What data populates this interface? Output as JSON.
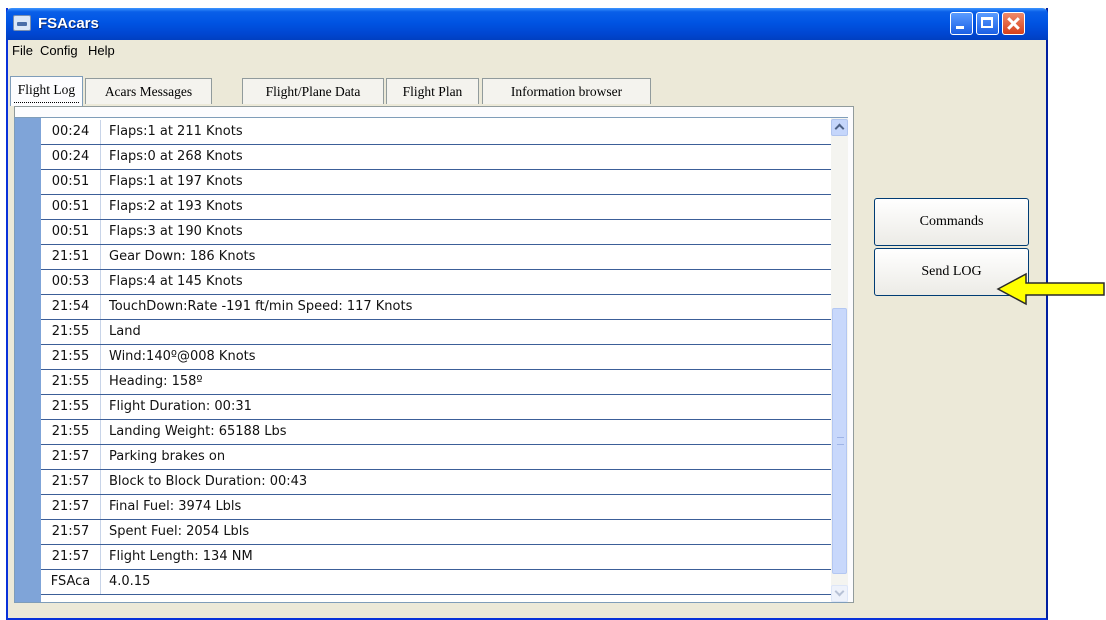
{
  "window": {
    "title": "FSAcars"
  },
  "menu": [
    "File",
    "Config",
    "Help"
  ],
  "tabs": [
    "Flight Log",
    "Acars Messages",
    "Flight/Plane Data",
    "Flight Plan",
    "Information browser"
  ],
  "log": [
    {
      "time": "00:24",
      "msg": "Flaps:1 at 211 Knots"
    },
    {
      "time": "00:24",
      "msg": "Flaps:0 at 268 Knots"
    },
    {
      "time": "00:51",
      "msg": "Flaps:1 at 197 Knots"
    },
    {
      "time": "00:51",
      "msg": "Flaps:2 at 193 Knots"
    },
    {
      "time": "00:51",
      "msg": "Flaps:3 at 190 Knots"
    },
    {
      "time": "21:51",
      "msg": "Gear Down: 186 Knots"
    },
    {
      "time": "00:53",
      "msg": "Flaps:4 at 145 Knots"
    },
    {
      "time": "21:54",
      "msg": "TouchDown:Rate -191 ft/min Speed: 117 Knots"
    },
    {
      "time": "21:55",
      "msg": "Land"
    },
    {
      "time": "21:55",
      "msg": "Wind:140º@008 Knots"
    },
    {
      "time": "21:55",
      "msg": "Heading: 158º"
    },
    {
      "time": "21:55",
      "msg": "Flight Duration: 00:31"
    },
    {
      "time": "21:55",
      "msg": "Landing Weight: 65188 Lbs"
    },
    {
      "time": "21:57",
      "msg": "Parking brakes on"
    },
    {
      "time": "21:57",
      "msg": "Block to Block Duration: 00:43"
    },
    {
      "time": "21:57",
      "msg": "Final Fuel: 3974 Lbls"
    },
    {
      "time": "21:57",
      "msg": "Spent Fuel: 2054 Lbls"
    },
    {
      "time": "21:57",
      "msg": "Flight Length: 134 NM"
    },
    {
      "time": "FSAca",
      "msg": "4.0.15"
    }
  ],
  "buttons": {
    "commands": "Commands",
    "send_log": "Send LOG"
  },
  "colors": {
    "titlebar": "#0054e3",
    "gutter": "#7fa4d8",
    "arrow_fill": "#ffff00",
    "button_border": "#003c74"
  }
}
